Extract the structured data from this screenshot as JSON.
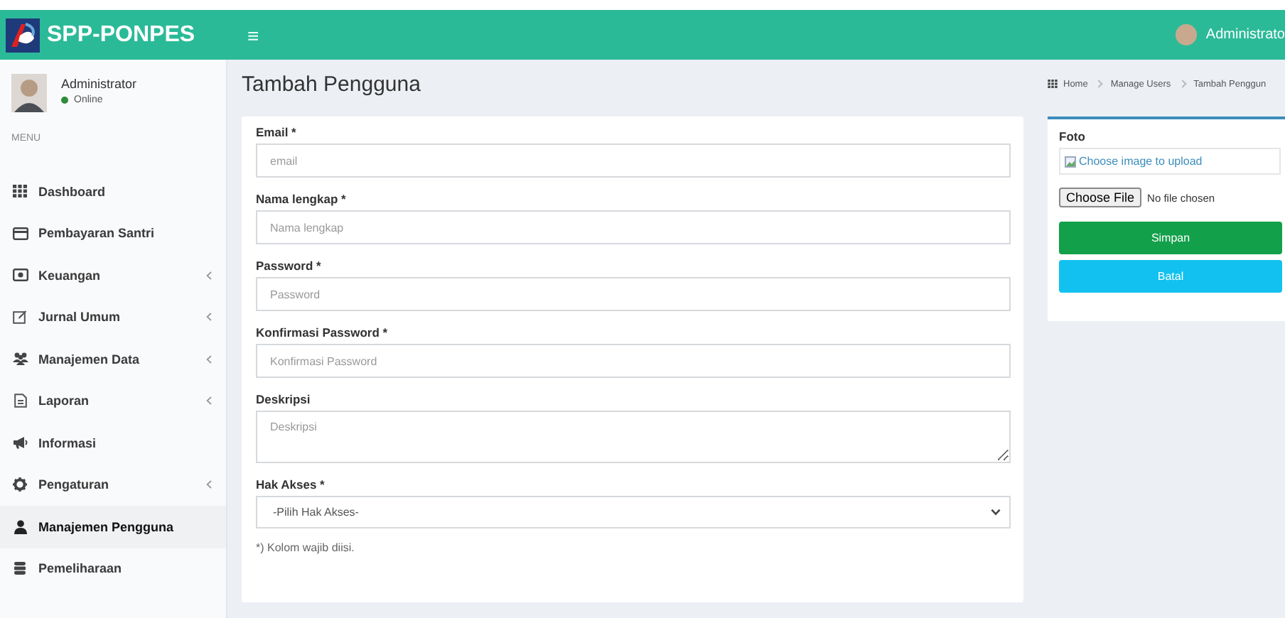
{
  "header": {
    "brand": "SPP-PONPES",
    "menu_icon": "≡",
    "user": "Administrato"
  },
  "sidebar": {
    "user": {
      "name": "Administrator",
      "status": "Online"
    },
    "menu_label": "MENU",
    "items": [
      {
        "label": "Dashboard",
        "has_submenu": false,
        "selected": false
      },
      {
        "label": "Pembayaran Santri",
        "has_submenu": false,
        "selected": false
      },
      {
        "label": "Keuangan",
        "has_submenu": true,
        "selected": false
      },
      {
        "label": "Jurnal Umum",
        "has_submenu": true,
        "selected": false
      },
      {
        "label": "Manajemen Data",
        "has_submenu": true,
        "selected": false
      },
      {
        "label": "Laporan",
        "has_submenu": true,
        "selected": false
      },
      {
        "label": "Informasi",
        "has_submenu": false,
        "selected": false
      },
      {
        "label": "Pengaturan",
        "has_submenu": true,
        "selected": false
      },
      {
        "label": "Manajemen Pengguna",
        "has_submenu": false,
        "selected": true
      },
      {
        "label": "Pemeliharaan",
        "has_submenu": false,
        "selected": false
      }
    ]
  },
  "page": {
    "title": "Tambah Pengguna",
    "breadcrumb": [
      "Home",
      "Manage Users",
      "Tambah Penggun"
    ]
  },
  "form": {
    "fields": [
      {
        "kind": "input",
        "label": "Email *",
        "placeholder": "email"
      },
      {
        "kind": "input",
        "label": "Nama lengkap *",
        "placeholder": "Nama lengkap"
      },
      {
        "kind": "input",
        "label": "Password *",
        "placeholder": "Password"
      },
      {
        "kind": "input",
        "label": "Konfirmasi Password *",
        "placeholder": "Konfirmasi Password"
      },
      {
        "kind": "textarea",
        "label": "Deskripsi",
        "placeholder": "Deskripsi"
      },
      {
        "kind": "select",
        "label": "Hak Akses *",
        "value": "-Pilih Hak Akses-"
      }
    ],
    "note": "*) Kolom wajib diisi."
  },
  "photo": {
    "label": "Foto",
    "image_alt": "Choose image to upload",
    "file_button": "Choose File",
    "file_status": "No file chosen",
    "buttons": [
      {
        "label": "Simpan",
        "kind": "primary"
      },
      {
        "label": "Batal",
        "kind": "info"
      }
    ]
  }
}
